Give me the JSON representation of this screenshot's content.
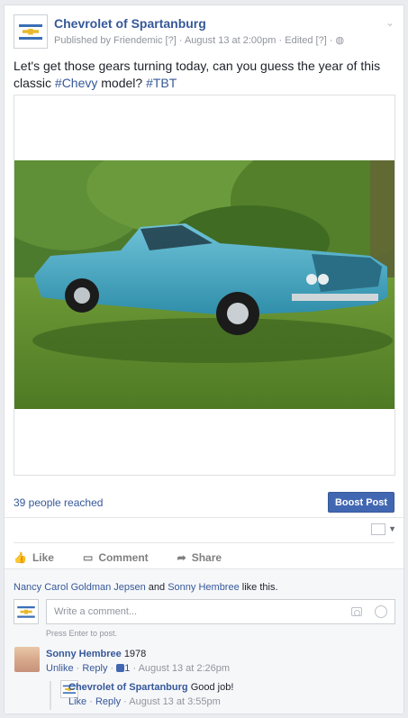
{
  "post": {
    "page_name": "Chevrolet of Spartanburg",
    "published_by": "Published by Friendemic",
    "help_marker": "[?]",
    "date": "August 13 at 2:00pm",
    "edited": "Edited",
    "text": "Let's get those gears turning today, can you guess the year of this classic",
    "hashtag1": "#Chevy",
    "text_mid": " model? ",
    "hashtag2": "#TBT"
  },
  "stats": {
    "reach": "39 people reached",
    "boost_label": "Boost Post"
  },
  "actions": {
    "like": "Like",
    "comment": "Comment",
    "share": "Share"
  },
  "likes": {
    "name1": "Nancy Carol Goldman Jepsen",
    "and": " and ",
    "name2": "Sonny Hembree",
    "suffix": " like this."
  },
  "composer": {
    "placeholder": "Write a comment...",
    "hint": "Press Enter to post."
  },
  "comments": [
    {
      "author": "Sonny Hembree",
      "text": "1978",
      "unlike": "Unlike",
      "reply": "Reply",
      "like_count": "1",
      "time": "August 13 at 2:26pm"
    },
    {
      "author": "Chevrolet of Spartanburg",
      "text": "Good job!",
      "like": "Like",
      "reply": "Reply",
      "time": "August 13 at 3:55pm"
    }
  ],
  "colors": {
    "link": "#365899",
    "boost": "#4267b2",
    "car": "#3fa6c4",
    "grass": "#5f8a2e"
  }
}
